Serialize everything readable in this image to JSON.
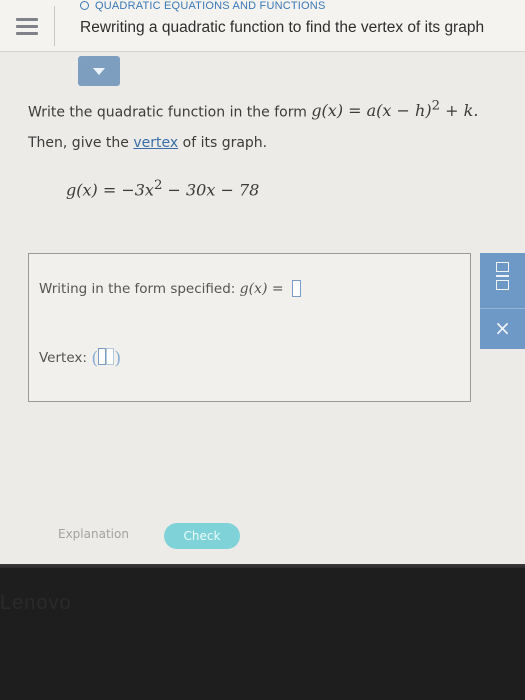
{
  "header": {
    "topic": "QUADRATIC EQUATIONS AND FUNCTIONS",
    "title": "Rewriting a quadratic function to find the vertex of its graph"
  },
  "question": {
    "line1_text": "Write the quadratic function in the form",
    "form": {
      "lhs": "g(x) = a(x − h)",
      "exp": "2",
      "rhs": " + k."
    },
    "line2_before": "Then, give the ",
    "line2_link": "vertex",
    "line2_after": " of its graph.",
    "equation": {
      "lhs": "g(x) = −3x",
      "exp": "2",
      "rhs": " − 30x − 78"
    }
  },
  "answer": {
    "form_label": "Writing in the form specified:",
    "form_math": "g(x) =",
    "vertex_label": "Vertex:",
    "vertex_open": "(",
    "vertex_close": ")"
  },
  "side_panel": {
    "fraction_icon": "fraction-icon",
    "clear_symbol": "×"
  },
  "footer": {
    "explanation_label": "Explanation",
    "check_label": "Check"
  },
  "bezel": {
    "brand": "Lenovo"
  },
  "colors": {
    "accent_blue": "#6e98c6",
    "check_button": "#7fd3d8",
    "topic_blue": "#3a78b8"
  }
}
